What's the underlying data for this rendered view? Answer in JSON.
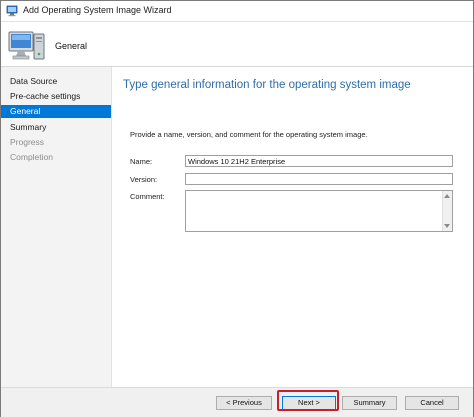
{
  "window": {
    "title": "Add Operating System Image Wizard",
    "title_icon": "wizard-computer-icon"
  },
  "header": {
    "icon": "computer-monitor-icon",
    "page_name": "General"
  },
  "sidebar": {
    "items": [
      {
        "label": "Data Source",
        "state": "normal"
      },
      {
        "label": "Pre-cache settings",
        "state": "normal"
      },
      {
        "label": "General",
        "state": "selected"
      },
      {
        "label": "Summary",
        "state": "normal"
      },
      {
        "label": "Progress",
        "state": "disabled"
      },
      {
        "label": "Completion",
        "state": "disabled"
      }
    ]
  },
  "content": {
    "title": "Type general information for the operating system image",
    "instructions": "Provide a name, version, and comment for the operating system image.",
    "fields": {
      "name": {
        "label": "Name:",
        "value": "Windows 10 21H2 Enterprise"
      },
      "version": {
        "label": "Version:",
        "value": ""
      },
      "comment": {
        "label": "Comment:",
        "value": ""
      }
    }
  },
  "footer": {
    "previous_label": "< Previous",
    "next_label": "Next >",
    "summary_label": "Summary",
    "cancel_label": "Cancel"
  },
  "colors": {
    "accent": "#0078d7",
    "title_blue": "#2e6da8",
    "highlight_red": "#c8202a"
  }
}
